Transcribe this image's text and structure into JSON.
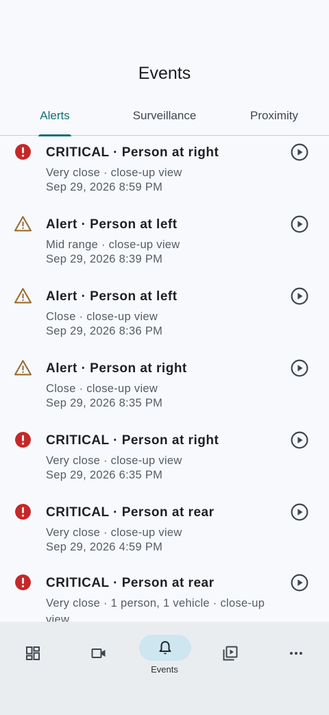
{
  "header": {
    "title": "Events"
  },
  "tabs": [
    {
      "label": "Alerts",
      "active": true
    },
    {
      "label": "Surveillance",
      "active": false
    },
    {
      "label": "Proximity",
      "active": false
    }
  ],
  "events": [
    {
      "severity": "critical",
      "icon": "exclamation-circle-icon",
      "title": "CRITICAL · Person at right",
      "detail": "Very close · close-up view",
      "time": "Sep 29, 2026 8:59 PM"
    },
    {
      "severity": "alert",
      "icon": "warning-triangle-icon",
      "title": "Alert · Person at left",
      "detail": "Mid range · close-up view",
      "time": "Sep 29, 2026 8:39 PM"
    },
    {
      "severity": "alert",
      "icon": "warning-triangle-icon",
      "title": "Alert · Person at left",
      "detail": "Close · close-up view",
      "time": "Sep 29, 2026 8:36 PM"
    },
    {
      "severity": "alert",
      "icon": "warning-triangle-icon",
      "title": "Alert · Person at right",
      "detail": "Close · close-up view",
      "time": "Sep 29, 2026 8:35 PM"
    },
    {
      "severity": "critical",
      "icon": "exclamation-circle-icon",
      "title": "CRITICAL · Person at right",
      "detail": "Very close · close-up view",
      "time": "Sep 29, 2026 6:35 PM"
    },
    {
      "severity": "critical",
      "icon": "exclamation-circle-icon",
      "title": "CRITICAL · Person at rear",
      "detail": "Very close · close-up view",
      "time": "Sep 29, 2026 4:59 PM"
    },
    {
      "severity": "critical",
      "icon": "exclamation-circle-icon",
      "title": "CRITICAL · Person at rear",
      "detail": "Very close · 1 person, 1 vehicle · close-up view",
      "time": ""
    }
  ],
  "colors": {
    "critical": "#c62828",
    "alert": "#9a6a2f",
    "accent": "#116e78",
    "active_pill": "#cde6f0"
  },
  "bottom_nav": [
    {
      "icon": "dashboard-icon",
      "label": "",
      "active": false
    },
    {
      "icon": "video-camera-icon",
      "label": "",
      "active": false
    },
    {
      "icon": "bell-icon",
      "label": "Events",
      "active": true
    },
    {
      "icon": "video-library-icon",
      "label": "",
      "active": false
    },
    {
      "icon": "more-horizontal-icon",
      "label": "",
      "active": false
    }
  ]
}
